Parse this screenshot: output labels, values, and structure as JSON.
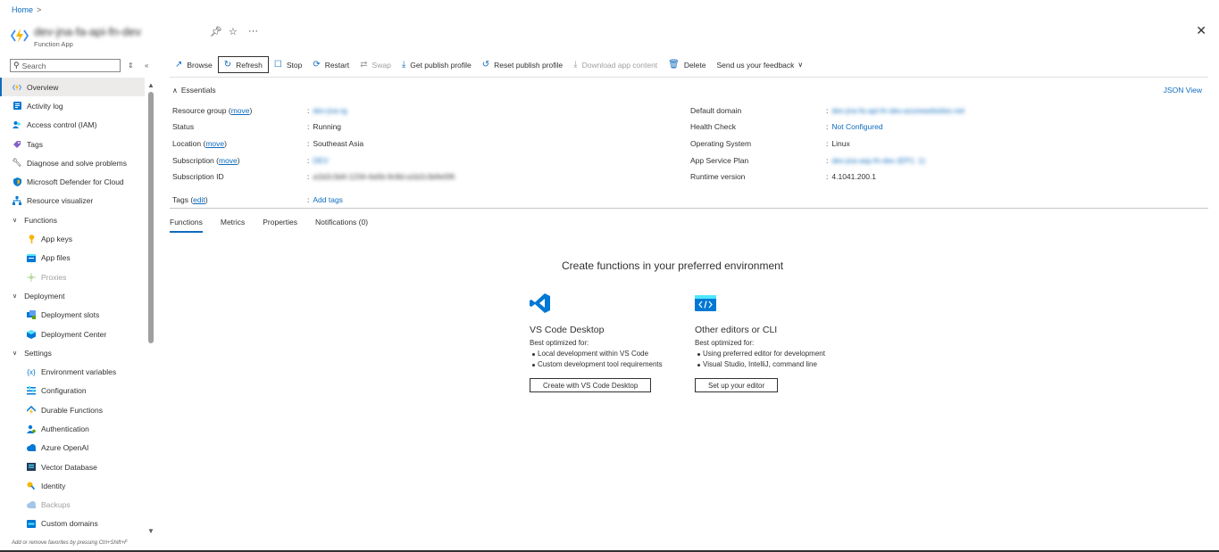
{
  "breadcrumb": {
    "home": "Home",
    "sep": ">"
  },
  "header": {
    "title": "dev-jna-fa-api-fn-dev",
    "subtitle": "Function App",
    "close": "✕"
  },
  "sidebar": {
    "search_placeholder": "Search",
    "items": [
      {
        "label": "Overview"
      },
      {
        "label": "Activity log"
      },
      {
        "label": "Access control (IAM)"
      },
      {
        "label": "Tags"
      },
      {
        "label": "Diagnose and solve problems"
      },
      {
        "label": "Microsoft Defender for Cloud"
      },
      {
        "label": "Resource visualizer"
      },
      {
        "label": "Functions"
      },
      {
        "label": "App keys"
      },
      {
        "label": "App files"
      },
      {
        "label": "Proxies"
      },
      {
        "label": "Deployment"
      },
      {
        "label": "Deployment slots"
      },
      {
        "label": "Deployment Center"
      },
      {
        "label": "Settings"
      },
      {
        "label": "Environment variables"
      },
      {
        "label": "Configuration"
      },
      {
        "label": "Durable Functions"
      },
      {
        "label": "Authentication"
      },
      {
        "label": "Azure OpenAI"
      },
      {
        "label": "Vector Database"
      },
      {
        "label": "Identity"
      },
      {
        "label": "Backups"
      },
      {
        "label": "Custom domains"
      }
    ],
    "favorites_hint": "Add or remove favorites by pressing Ctrl+Shift+F"
  },
  "toolbar": {
    "browse": "Browse",
    "refresh": "Refresh",
    "stop": "Stop",
    "restart": "Restart",
    "swap": "Swap",
    "get_publish_profile": "Get publish profile",
    "reset_publish_profile": "Reset publish profile",
    "download_app_content": "Download app content",
    "delete": "Delete",
    "feedback": "Send us your feedback"
  },
  "essentials": {
    "title": "Essentials",
    "json_view": "JSON View",
    "move": "move",
    "edit": "edit",
    "left": {
      "resource_group_label": "Resource group",
      "resource_group_value": "dev-jna-rg",
      "status_label": "Status",
      "status_value": "Running",
      "location_label": "Location",
      "location_value": "Southeast Asia",
      "subscription_label": "Subscription",
      "subscription_value": "DEV",
      "subscription_id_label": "Subscription ID",
      "subscription_id_value": "a1b2c3d4-1234-4a5b-9c8d-a1b2c3d4e5f6",
      "tags_label": "Tags",
      "tags_value": "Add tags"
    },
    "right": {
      "default_domain_label": "Default domain",
      "default_domain_value": "dev-jna-fa-api-fn-dev.azurewebsites.net",
      "health_check_label": "Health Check",
      "health_check_value": "Not Configured",
      "os_label": "Operating System",
      "os_value": "Linux",
      "plan_label": "App Service Plan",
      "plan_value": "dev-jna-asp-fn-dev (EP1: 1)",
      "runtime_label": "Runtime version",
      "runtime_value": "4.1041.200.1"
    }
  },
  "tabs": [
    "Functions",
    "Metrics",
    "Properties",
    "Notifications (0)"
  ],
  "create": {
    "heading": "Create functions in your preferred environment",
    "vscode": {
      "title": "VS Code Desktop",
      "best": "Best optimized for:",
      "bullets": [
        "Local development within VS Code",
        "Custom development tool requirements"
      ],
      "button": "Create with VS Code Desktop"
    },
    "other": {
      "title": "Other editors or CLI",
      "best": "Best optimized for:",
      "bullets": [
        "Using preferred editor for development",
        "Visual Studio, IntelliJ, command line"
      ],
      "button": "Set up your editor"
    }
  },
  "colors": {
    "accent": "#0f6cbd",
    "text": "#323130",
    "muted": "#a19f9d"
  }
}
